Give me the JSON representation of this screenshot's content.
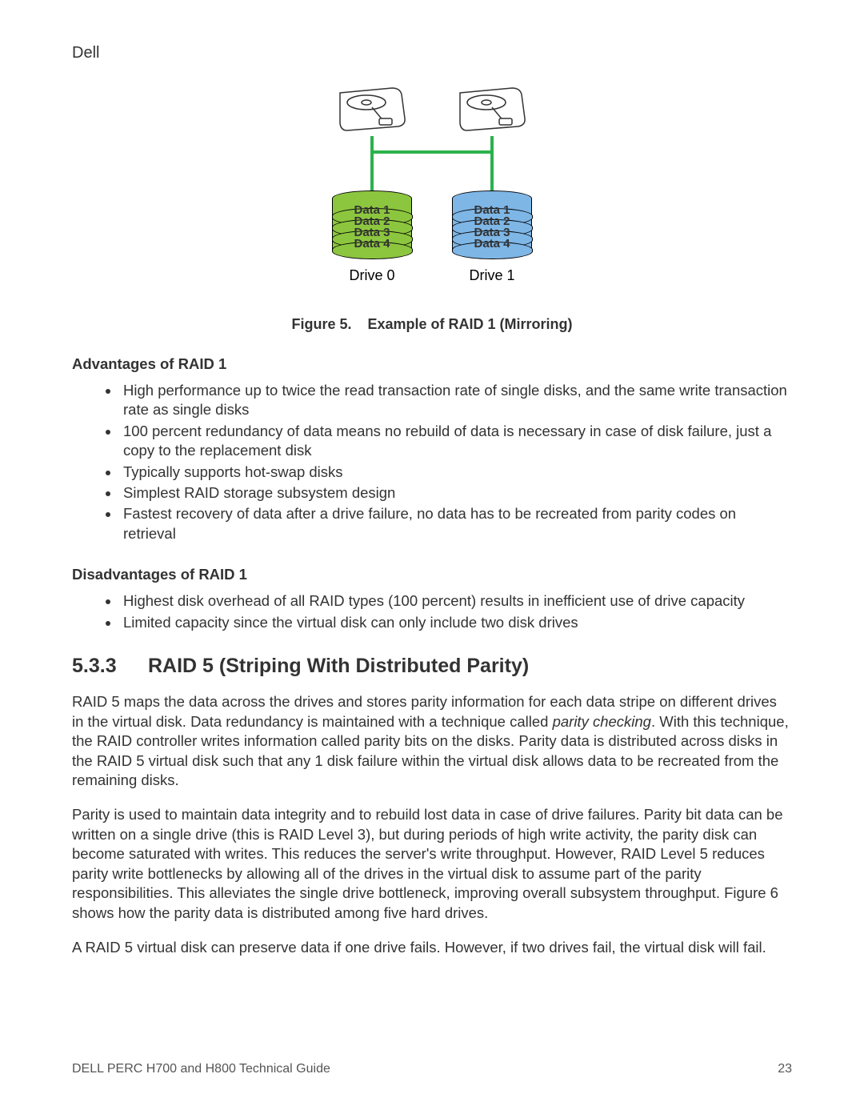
{
  "header": {
    "brand": "Dell"
  },
  "figure": {
    "drive0": {
      "label": "Drive 0",
      "segments": [
        "Data 1",
        "Data 2",
        "Data 3",
        "Data 4"
      ]
    },
    "drive1": {
      "label": "Drive 1",
      "segments": [
        "Data 1",
        "Data 2",
        "Data 3",
        "Data 4"
      ]
    },
    "caption_prefix": "Figure 5.",
    "caption_text": "Example of RAID 1 (Mirroring)"
  },
  "advantages": {
    "heading": "Advantages of RAID 1",
    "items": [
      "High performance up to twice the read transaction rate of single disks, and the same write transaction rate as single disks",
      "100 percent redundancy of data means no rebuild of data is necessary in case of disk failure, just a copy to the replacement disk",
      "Typically supports hot-swap disks",
      "Simplest RAID storage subsystem design",
      "Fastest recovery of data after a drive failure, no data has to be recreated from parity codes on retrieval"
    ]
  },
  "disadvantages": {
    "heading": "Disadvantages of RAID 1",
    "items": [
      "Highest disk overhead of all RAID types (100 percent) results in inefficient use of drive capacity",
      "Limited capacity since the virtual disk can only include two disk drives"
    ]
  },
  "section": {
    "number": "5.3.3",
    "title": "RAID 5 (Striping With Distributed Parity)",
    "p1_a": "RAID 5 maps the data across the drives and stores parity information for each data stripe on different drives in the virtual disk. Data redundancy is maintained with a technique called ",
    "p1_em": "parity checking",
    "p1_b": ". With this technique, the RAID controller writes information called parity bits on the disks. Parity data is distributed across disks in the RAID 5 virtual disk such that any 1 disk failure within the virtual disk allows data to be recreated from the remaining disks.",
    "p2": "Parity is used to maintain data integrity and to rebuild lost data in case of drive failures. Parity bit data can be written on a single drive (this is RAID Level 3), but during periods of high write activity, the parity disk can become saturated with writes. This reduces the server's write throughput. However, RAID Level 5 reduces parity write bottlenecks by allowing all of the drives in the virtual disk to assume part of the parity responsibilities. This alleviates the single drive bottleneck, improving overall subsystem throughput. Figure 6 shows how the parity data is distributed among five hard drives.",
    "p3": "A RAID 5 virtual disk can preserve data if one drive fails. However, if two drives fail, the virtual disk will fail."
  },
  "footer": {
    "left": "DELL PERC H700 and H800 Technical Guide",
    "right": "23"
  }
}
